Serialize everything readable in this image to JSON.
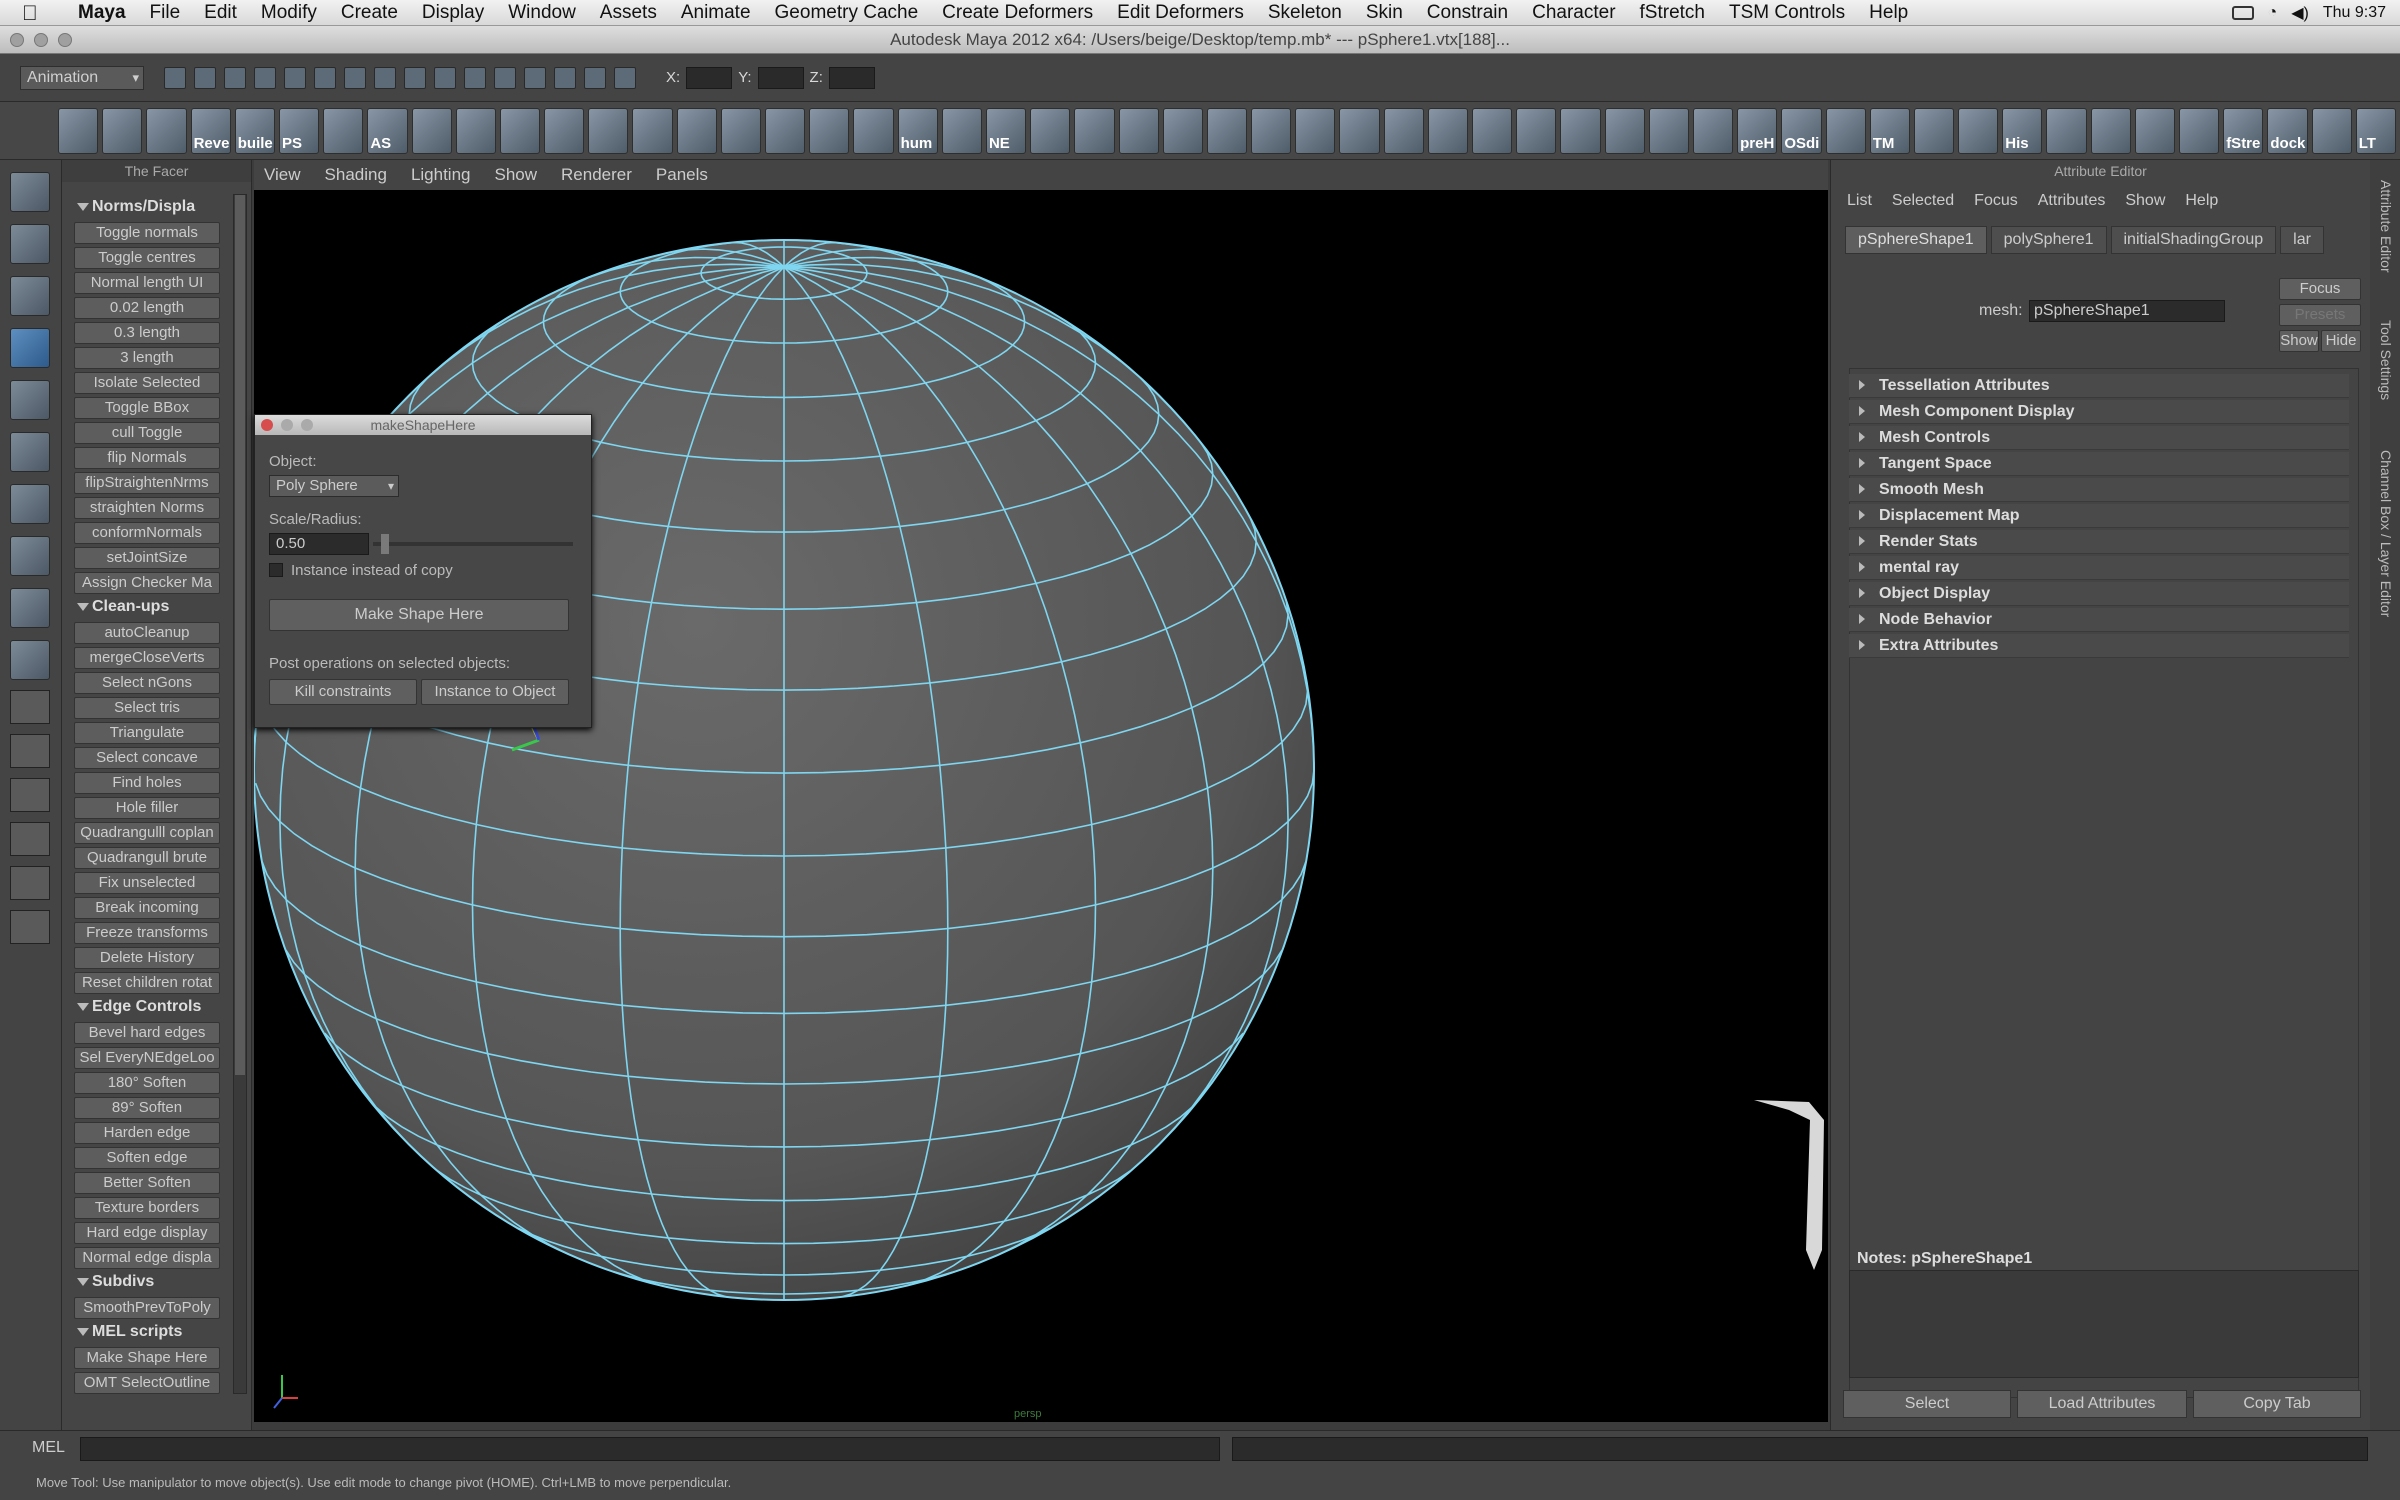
{
  "system_menu": {
    "items": [
      "Maya",
      "File",
      "Edit",
      "Modify",
      "Create",
      "Display",
      "Window",
      "Assets",
      "Animate",
      "Geometry Cache",
      "Create Deformers",
      "Edit Deformers",
      "Skeleton",
      "Skin",
      "Constrain",
      "Character",
      "fStretch",
      "TSM Controls",
      "Help"
    ],
    "clock": "Thu 9:37"
  },
  "window_title": "Autodesk Maya 2012 x64: /Users/beige/Desktop/temp.mb*   ---   pSphere1.vtx[188]...",
  "status_line": {
    "mode": "Animation",
    "x_label": "X:",
    "y_label": "Y:",
    "z_label": "Z:"
  },
  "shelf": {
    "tools": [
      "",
      "",
      "",
      "Reve",
      "buile",
      "PS",
      "",
      "AS",
      "",
      "",
      "",
      "",
      "",
      "",
      "",
      "",
      "",
      "",
      "",
      "hum",
      "",
      "NE",
      "",
      "",
      "",
      "",
      "",
      "",
      "",
      "",
      "",
      "",
      "",
      "",
      "",
      "",
      "",
      "",
      "preH",
      "OSdi",
      "",
      "TM",
      "",
      "",
      "His",
      "",
      "",
      "",
      "",
      "fStre",
      "dock",
      "",
      "LT"
    ]
  },
  "facer": {
    "title": "The Facer",
    "sections": [
      {
        "label": "Norms/Displa",
        "buttons": [
          "Toggle normals",
          "Toggle centres",
          "Normal length UI",
          "0.02 length",
          "0.3 length",
          "3 length",
          "Isolate Selected",
          "Toggle BBox",
          "cull Toggle",
          "flip Normals",
          "flipStraightenNrms",
          "straighten Norms",
          "conformNormals",
          "setJointSize",
          "Assign Checker Ma"
        ]
      },
      {
        "label": "Clean-ups",
        "buttons": [
          "autoCleanup",
          "mergeCloseVerts",
          "Select nGons",
          "Select tris",
          "Triangulate",
          "Select concave",
          "Find holes",
          "Hole filler",
          "Quadrangulll coplan",
          "Quadrangull brute",
          "Fix unselected",
          "Break incoming",
          "Freeze transforms",
          "Delete History",
          "Reset children rotat"
        ]
      },
      {
        "label": "Edge Controls",
        "buttons": [
          "Bevel hard edges",
          "Sel EveryNEdgeLoo",
          "180° Soften",
          "89° Soften",
          "Harden edge",
          "Soften edge",
          "Better Soften",
          "Texture borders",
          "Hard edge display",
          "Normal edge displa"
        ]
      },
      {
        "label": "Subdivs",
        "buttons": [
          "SmoothPrevToPoly"
        ]
      },
      {
        "label": "MEL scripts",
        "buttons": [
          "Make Shape Here",
          "OMT SelectOutline"
        ]
      }
    ]
  },
  "viewport": {
    "menus": [
      "View",
      "Shading",
      "Lighting",
      "Show",
      "Renderer",
      "Panels"
    ],
    "camera_label": "persp"
  },
  "dialog": {
    "title": "makeShapeHere",
    "object_label": "Object:",
    "object_value": "Poly Sphere",
    "scale_label": "Scale/Radius:",
    "scale_value": "0.50",
    "instance_label": "Instance instead of copy",
    "make_button": "Make Shape Here",
    "post_label": "Post operations on selected objects:",
    "kill_button": "Kill constraints",
    "instance_button": "Instance to Object"
  },
  "attribute_editor": {
    "title": "Attribute Editor",
    "menus": [
      "List",
      "Selected",
      "Focus",
      "Attributes",
      "Show",
      "Help"
    ],
    "tabs": [
      "pSphereShape1",
      "polySphere1",
      "initialShadingGroup",
      "lar"
    ],
    "mesh_label": "mesh:",
    "mesh_value": "pSphereShape1",
    "focus_button": "Focus",
    "presets_button": "Presets",
    "show_button": "Show",
    "hide_button": "Hide",
    "sections": [
      "Tessellation Attributes",
      "Mesh Component Display",
      "Mesh Controls",
      "Tangent Space",
      "Smooth Mesh",
      "Displacement Map",
      "Render Stats",
      "mental ray",
      "Object Display",
      "Node Behavior",
      "Extra Attributes"
    ],
    "notes_label": "Notes:  pSphereShape1",
    "footer": [
      "Select",
      "Load Attributes",
      "Copy Tab"
    ]
  },
  "side_tabs": [
    "Attribute Editor",
    "Tool Settings",
    "Channel Box / Layer Editor"
  ],
  "command_line": {
    "label": "MEL"
  },
  "help_line": "Move Tool: Use manipulator to move object(s). Use edit mode to change pivot (HOME). Ctrl+LMB to move perpendicular.",
  "colors": {
    "wire": "#7fd6f0",
    "selected_vertex": "#d8f04a",
    "viewport_bg": "#000000"
  }
}
